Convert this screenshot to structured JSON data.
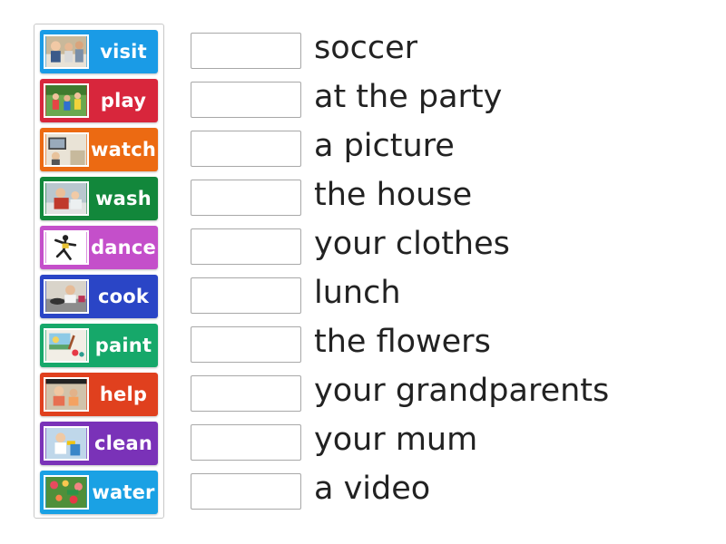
{
  "tiles": [
    {
      "label": "visit",
      "color": "#1a9be6",
      "icon": "family-visit-photo-icon"
    },
    {
      "label": "play",
      "color": "#d8263c",
      "icon": "kids-playing-photo-icon"
    },
    {
      "label": "watch",
      "color": "#ec6a12",
      "icon": "watching-tv-photo-icon"
    },
    {
      "label": "wash",
      "color": "#12873b",
      "icon": "washing-photo-icon"
    },
    {
      "label": "dance",
      "color": "#c44fca",
      "icon": "dancer-photo-icon"
    },
    {
      "label": "cook",
      "color": "#2a45c6",
      "icon": "cooking-photo-icon"
    },
    {
      "label": "paint",
      "color": "#16a86a",
      "icon": "painting-photo-icon"
    },
    {
      "label": "help",
      "color": "#e0401e",
      "icon": "helping-photo-icon"
    },
    {
      "label": "clean",
      "color": "#7a32b8",
      "icon": "cleaning-photo-icon"
    },
    {
      "label": "water",
      "color": "#1aa1e4",
      "icon": "watering-plants-photo-icon"
    }
  ],
  "phrases": [
    "soccer",
    "at the party",
    "a picture",
    "the house",
    "your clothes",
    "lunch",
    "the flowers",
    "your grandparents",
    "your mum",
    "a video"
  ]
}
